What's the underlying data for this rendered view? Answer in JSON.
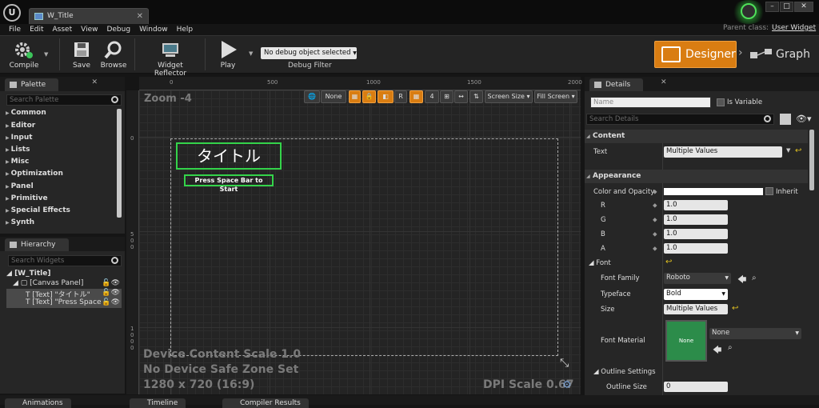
{
  "window": {
    "tab_title": "W_Title",
    "parent_class_label": "Parent class:",
    "parent_class_value": "User Widget",
    "ue_logo": "U"
  },
  "menu": [
    "File",
    "Edit",
    "Asset",
    "View",
    "Debug",
    "Window",
    "Help"
  ],
  "toolbar": {
    "compile": "Compile",
    "save": "Save",
    "browse": "Browse",
    "widget_reflector": "Widget Reflector",
    "play": "Play",
    "debug_object": "No debug object selected",
    "debug_filter": "Debug Filter",
    "designer": "Designer",
    "graph": "Graph"
  },
  "palette": {
    "tab": "Palette",
    "search_placeholder": "Search Palette",
    "categories": [
      "Common",
      "Editor",
      "Input",
      "Lists",
      "Misc",
      "Optimization",
      "Panel",
      "Primitive",
      "Special Effects",
      "Synth"
    ]
  },
  "hierarchy": {
    "tab": "Hierarchy",
    "search_placeholder": "Search Widgets",
    "root": "[W_Title]",
    "canvas": "[Canvas Panel]",
    "items": [
      "[Text] \"タイトル\"",
      "[Text] \"Press Space"
    ]
  },
  "designer_view": {
    "zoom": "Zoom -4",
    "ruler_top": [
      "0",
      "500",
      "1000",
      "1500",
      "2000"
    ],
    "ruler_left": [
      "0",
      "5\n0\n0",
      "1\n0\n0\n0"
    ],
    "view_none": "None",
    "view_r": "R",
    "view_grid": "4",
    "screen_size": "Screen Size",
    "fill_screen": "Fill Screen",
    "title_text": "タイトル",
    "press_text": "Press Space Bar to Start",
    "device_scale": "Device Content Scale 1.0",
    "safe_zone": "No Device Safe Zone Set",
    "resolution": "1280 x 720 (16:9)",
    "dpi": "DPI Scale 0.67"
  },
  "details": {
    "tab": "Details",
    "name_placeholder": "Name",
    "is_variable": "Is Variable",
    "search_placeholder": "Search Details",
    "content_section": "Content",
    "text_label": "Text",
    "text_value": "Multiple Values",
    "appearance_section": "Appearance",
    "color_label": "Color and Opacity",
    "inherit": "Inherit",
    "r": "R",
    "g": "G",
    "b": "B",
    "a": "A",
    "r_val": "1.0",
    "g_val": "1.0",
    "b_val": "1.0",
    "a_val": "1.0",
    "font_label": "Font",
    "font_family_label": "Font Family",
    "font_family": "Roboto",
    "typeface_label": "Typeface",
    "typeface": "Bold",
    "size_label": "Size",
    "size": "Multiple Values",
    "font_material_label": "Font Material",
    "material_thumb": "None",
    "material_value": "None",
    "outline_settings": "Outline Settings",
    "outline_size_label": "Outline Size",
    "outline_size": "0"
  },
  "bottom": {
    "animations": "Animations",
    "timeline": "Timeline",
    "compiler": "Compiler Results"
  },
  "colors": {
    "accent": "#d97d12",
    "widget_outline": "#34d34a"
  }
}
